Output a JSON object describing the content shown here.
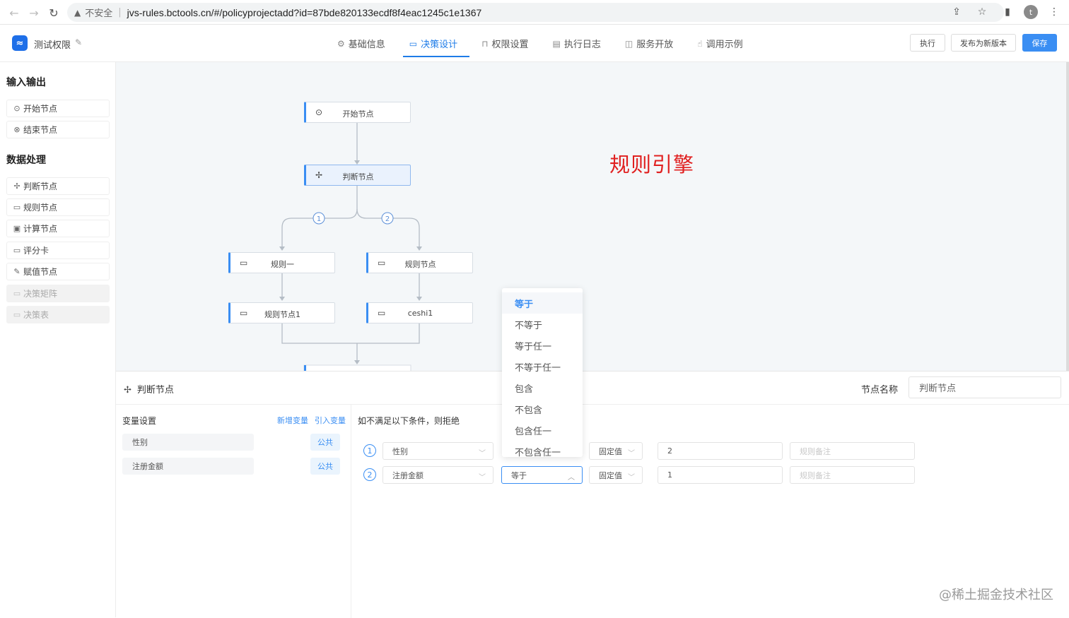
{
  "browser": {
    "security_text": "不安全",
    "url": "jvs-rules.bctools.cn/#/policyprojectadd?id=87bde820133ecdf8f4eac1245c1e1367",
    "profile_initial": "t"
  },
  "header": {
    "app_name": "测试权限",
    "tabs": [
      {
        "label": "基础信息",
        "icon": "gear-icon"
      },
      {
        "label": "决策设计",
        "icon": "monitor-icon",
        "active": true
      },
      {
        "label": "权限设置",
        "icon": "lock-icon"
      },
      {
        "label": "执行日志",
        "icon": "document-icon"
      },
      {
        "label": "服务开放",
        "icon": "book-icon"
      },
      {
        "label": "调用示例",
        "icon": "hand-icon"
      }
    ],
    "run_label": "执行",
    "publish_label": "发布为新版本",
    "save_label": "保存"
  },
  "sidebar": {
    "io_title": "输入输出",
    "io_items": [
      {
        "label": "开始节点",
        "icon": "play-icon"
      },
      {
        "label": "结束节点",
        "icon": "stop-icon"
      }
    ],
    "processing_title": "数据处理",
    "processing_items": [
      {
        "label": "判断节点",
        "icon": "move-icon"
      },
      {
        "label": "规则节点",
        "icon": "card-icon"
      },
      {
        "label": "计算节点",
        "icon": "calculator-icon"
      },
      {
        "label": "评分卡",
        "icon": "card-icon"
      },
      {
        "label": "赋值节点",
        "icon": "edit-icon"
      },
      {
        "label": "决策矩阵",
        "icon": "card-icon",
        "disabled": true
      },
      {
        "label": "决策表",
        "icon": "card-icon",
        "disabled": true
      }
    ]
  },
  "canvas": {
    "nodes": {
      "start": "开始节点",
      "judge": "判断节点",
      "rule_one": "规则一",
      "rule_node": "规则节点",
      "rule_node_1": "规则节点1",
      "ceshi": "ceshi1"
    },
    "branch_labels": [
      "1",
      "2"
    ],
    "overlay_title": "规则引擎"
  },
  "config": {
    "title": "判断节点",
    "node_name_label": "节点名称",
    "node_name_value": "判断节点",
    "var_title": "变量设置",
    "add_var": "新增变量",
    "import_var": "引入变量",
    "variables": [
      {
        "name": "性别",
        "tag": "公共"
      },
      {
        "name": "注册金额",
        "tag": "公共"
      }
    ],
    "rule_title": "如不满足以下条件，则拒绝",
    "rows": [
      {
        "index": "1",
        "field": "性别",
        "operator": "",
        "value_type": "固定值",
        "value": "2",
        "remark_placeholder": "规则备注"
      },
      {
        "index": "2",
        "field": "注册金额",
        "operator": "等于",
        "value_type": "固定值",
        "value": "1",
        "remark_placeholder": "规则备注"
      }
    ]
  },
  "dropdown": {
    "options": [
      "等于",
      "不等于",
      "等于任一",
      "不等于任一",
      "包含",
      "不包含",
      "包含任一",
      "不包含任一"
    ],
    "selected": "等于"
  },
  "watermark": "@稀土掘金技术社区",
  "colors": {
    "accent": "#3a8ef3",
    "title_red": "#e02020",
    "canvas_bg": "#f4f7f9"
  }
}
